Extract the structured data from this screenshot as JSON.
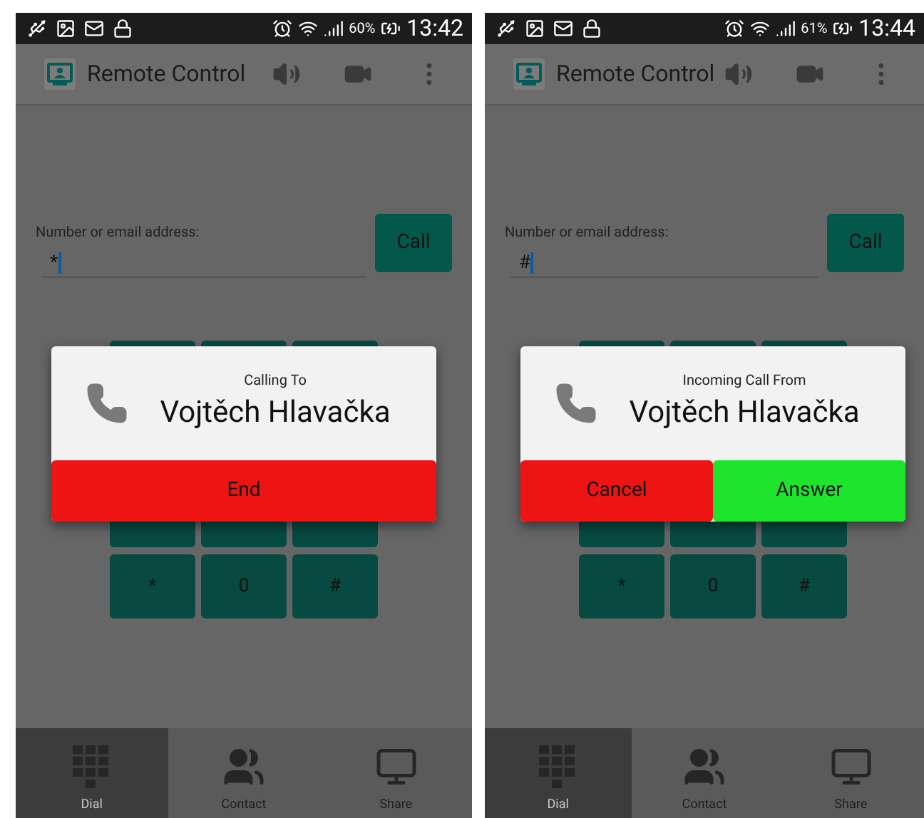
{
  "screens": [
    {
      "status_bar": {
        "battery": "60%",
        "time": "13:42"
      },
      "app_bar": {
        "title": "Remote Control"
      },
      "dial_form": {
        "label": "Number or email address:",
        "value": "*",
        "call_button": "Call"
      },
      "keypad_keys": [
        "*",
        "0",
        "#"
      ],
      "dialog": {
        "subtitle": "Calling To",
        "name": "Vojtěch Hlavačka",
        "buttons": [
          {
            "label": "End",
            "kind": "decline"
          }
        ]
      },
      "bottom_nav": [
        {
          "label": "Dial",
          "kind": "dial",
          "selected": true
        },
        {
          "label": "Contact",
          "kind": "contact",
          "selected": false
        },
        {
          "label": "Share",
          "kind": "share",
          "selected": false
        }
      ]
    },
    {
      "status_bar": {
        "battery": "61%",
        "time": "13:44"
      },
      "app_bar": {
        "title": "Remote Control"
      },
      "dial_form": {
        "label": "Number or email address:",
        "value": "#",
        "call_button": "Call"
      },
      "keypad_keys": [
        "*",
        "0",
        "#"
      ],
      "dialog": {
        "subtitle": "Incoming Call From",
        "name": "Vojtěch Hlavačka",
        "buttons": [
          {
            "label": "Cancel",
            "kind": "decline"
          },
          {
            "label": "Answer",
            "kind": "accept"
          }
        ]
      },
      "bottom_nav": [
        {
          "label": "Dial",
          "kind": "dial",
          "selected": true
        },
        {
          "label": "Contact",
          "kind": "contact",
          "selected": false
        },
        {
          "label": "Share",
          "kind": "share",
          "selected": false
        }
      ]
    }
  ]
}
